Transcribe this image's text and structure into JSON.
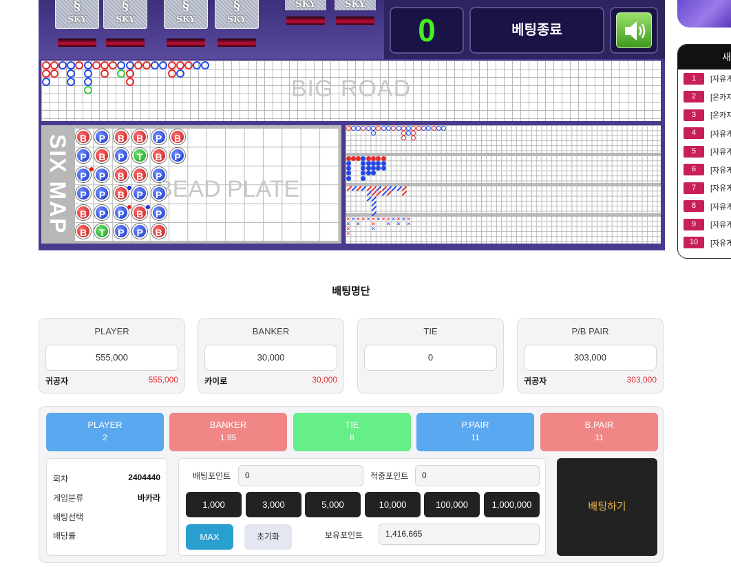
{
  "board": {
    "cards": [
      {
        "label": "SKY"
      },
      {
        "label": "SKY"
      },
      {
        "label": "SKY"
      },
      {
        "label": "SKY"
      }
    ],
    "small_cards": [
      {
        "label": "SKY"
      },
      {
        "label": "SKY"
      }
    ],
    "count": "0",
    "status": "베팅종료",
    "big_road_label": "BIG ROAD",
    "six_map_label": "SIX MAP",
    "bead_plate_label": "BEAD PLATE",
    "big_road": [
      [
        "b",
        "b",
        "p"
      ],
      [
        "b",
        "b"
      ],
      [
        "p"
      ],
      [
        "p",
        "p",
        "p"
      ],
      [
        "b"
      ],
      [
        "p",
        "p",
        "p",
        "t"
      ],
      [
        "b"
      ],
      [
        "b",
        "b"
      ],
      [
        "b"
      ],
      [
        "p",
        "t"
      ],
      [
        "p",
        "b",
        "b"
      ],
      [
        "b"
      ],
      [
        "b"
      ],
      [
        "p"
      ],
      [
        "p"
      ],
      [
        "b",
        "b"
      ],
      [
        "b",
        "p"
      ],
      [
        "b"
      ],
      [
        "p"
      ],
      [
        "p"
      ]
    ],
    "bead_plate": [
      [
        "b",
        "p",
        "p",
        "p",
        "b",
        "b"
      ],
      [
        "p",
        "b",
        "p",
        "p",
        "p",
        "t"
      ],
      [
        "b",
        "p",
        "b",
        "b",
        "p",
        "p"
      ],
      [
        "b",
        "t",
        "b",
        "p",
        "b",
        "p"
      ],
      [
        "p",
        "b",
        "p",
        "p",
        "p",
        "b"
      ],
      [
        "b",
        "p",
        "",
        "",
        "",
        ""
      ]
    ],
    "bead_labels": {
      "b": "B",
      "p": "P",
      "t": "T"
    }
  },
  "sidebar": {
    "header": "새",
    "items": [
      {
        "num": "1",
        "text": "[자유게"
      },
      {
        "num": "2",
        "text": "[온카지"
      },
      {
        "num": "3",
        "text": "[온카지"
      },
      {
        "num": "4",
        "text": "[자유게"
      },
      {
        "num": "5",
        "text": "[자유게"
      },
      {
        "num": "6",
        "text": "[자유게"
      },
      {
        "num": "7",
        "text": "[자유게"
      },
      {
        "num": "8",
        "text": "[자유게"
      },
      {
        "num": "9",
        "text": "[자유게"
      },
      {
        "num": "10",
        "text": "[자유게"
      }
    ]
  },
  "bet_list": {
    "title": "배팅명단",
    "cards": [
      {
        "title": "PLAYER",
        "total": "555,000",
        "user": "귀공자",
        "amount": "555,000"
      },
      {
        "title": "BANKER",
        "total": "30,000",
        "user": "카이로",
        "amount": "30,000"
      },
      {
        "title": "TIE",
        "total": "0",
        "user": "",
        "amount": ""
      },
      {
        "title": "P/B PAIR",
        "total": "303,000",
        "user": "귀공자",
        "amount": "303,000"
      }
    ]
  },
  "odds": [
    {
      "name": "PLAYER",
      "odds": "2",
      "color": "#5aa8f0"
    },
    {
      "name": "BANKER",
      "odds": "1.95",
      "color": "#f08686"
    },
    {
      "name": "TIE",
      "odds": "8",
      "color": "#66ee88"
    },
    {
      "name": "P.PAIR",
      "odds": "11",
      "color": "#5aa8f0"
    },
    {
      "name": "B.PAIR",
      "odds": "11",
      "color": "#f08686"
    }
  ],
  "round_info": {
    "round_label": "회차",
    "round_value": "2404440",
    "game_label": "게임분류",
    "game_value": "바카라",
    "select_label": "배팅선택",
    "select_value": "",
    "rate_label": "배당률",
    "rate_value": ""
  },
  "controls": {
    "bet_point_label": "배팅포인트",
    "bet_point_value": "0",
    "hit_point_label": "적중포인트",
    "hit_point_value": "0",
    "chips": [
      "1,000",
      "3,000",
      "5,000",
      "10,000",
      "100,000",
      "1,000,000"
    ],
    "max_label": "MAX",
    "reset_label": "초기화",
    "hold_point_label": "보유포인트",
    "hold_point_value": "1,416,665"
  },
  "place_bet_label": "배팅하기"
}
